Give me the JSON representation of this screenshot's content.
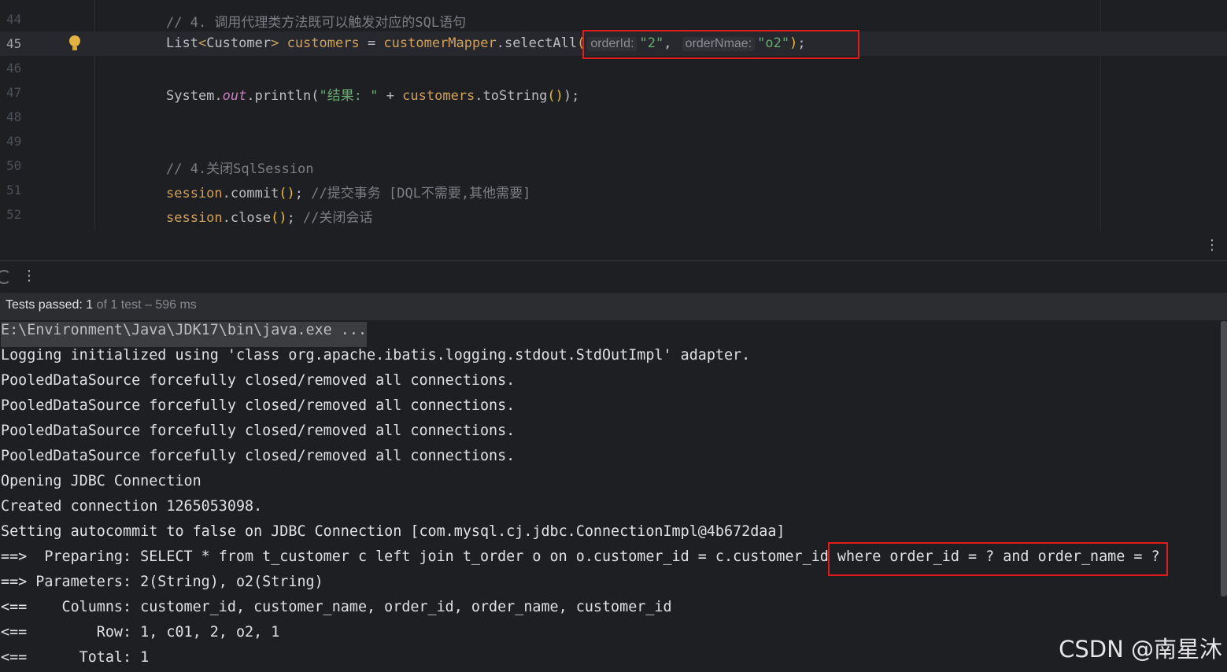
{
  "editor": {
    "current_line": "45",
    "lines": [
      {
        "no": "44",
        "comment": "// 4. 调用代理类方法既可以触发对应的SQL语句"
      },
      {
        "no": "45",
        "type_name": "List",
        "generic": "Customer",
        "var": "customers",
        "assign": " = ",
        "mapper": "customerMapper",
        "method": ".selectAll",
        "hint1": "orderId:",
        "arg1": "\"2\"",
        "hint2": "orderNmae:",
        "arg2": "\"o2\""
      },
      {
        "no": "46"
      },
      {
        "no": "47",
        "system": "System.",
        "out": "out",
        "println": ".println(",
        "str": "\"结果: \"",
        "plus": " + ",
        "var": "customers",
        "tostring": ".toString",
        "end": ");"
      },
      {
        "no": "48"
      },
      {
        "no": "49"
      },
      {
        "no": "50",
        "comment": "// 4.关闭SqlSession"
      },
      {
        "no": "51",
        "session": "session",
        "call": ".commit",
        "rest": "; ",
        "comment": "//提交事务 [DQL不需要,其他需要]"
      },
      {
        "no": "52",
        "session": "session",
        "call": ".close",
        "rest": "; ",
        "comment": "//关闭会话"
      }
    ]
  },
  "run_panel": {
    "status_passed_label": "Tests passed: 1",
    "status_of": " of 1 test – 596 ms"
  },
  "console": {
    "lines": [
      "E:\\Environment\\Java\\JDK17\\bin\\java.exe ...",
      "Logging initialized using 'class org.apache.ibatis.logging.stdout.StdOutImpl' adapter.",
      "PooledDataSource forcefully closed/removed all connections.",
      "PooledDataSource forcefully closed/removed all connections.",
      "PooledDataSource forcefully closed/removed all connections.",
      "PooledDataSource forcefully closed/removed all connections.",
      "Opening JDBC Connection",
      "Created connection 1265053098.",
      "Setting autocommit to false on JDBC Connection [com.mysql.cj.jdbc.ConnectionImpl@4b672daa]",
      "==>  Preparing: SELECT * from t_customer c left join t_order o on o.customer_id = c.customer_id where order_id = ? and order_name = ?",
      "==> Parameters: 2(String), o2(String)",
      "<==    Columns: customer_id, customer_name, order_id, order_name, customer_id",
      "<==        Row: 1, c01, 2, o2, 1",
      "<==      Total: 1"
    ]
  },
  "watermark": "CSDN @南星沐",
  "colors": {
    "background": "#1e1f22",
    "highlight_box": "#e01b1b",
    "string": "#6aab73",
    "comment": "#7a7e85"
  }
}
